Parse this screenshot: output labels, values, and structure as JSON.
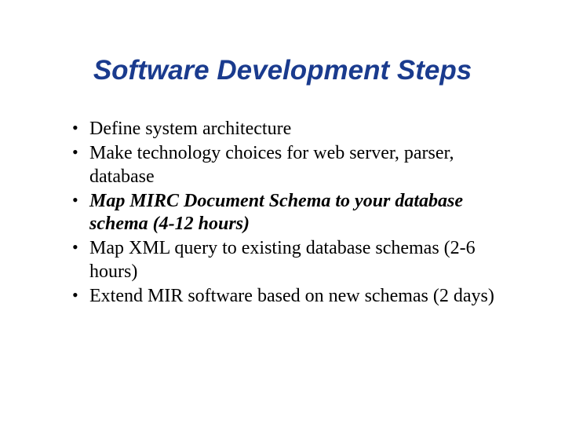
{
  "title": "Software Development Steps",
  "bullets": [
    {
      "text": "Define system architecture",
      "emphasis": "none"
    },
    {
      "text": "Make technology choices for web server, parser, database",
      "emphasis": "none"
    },
    {
      "text": "Map MIRC Document Schema to your database schema (4-12 hours)",
      "emphasis": "bold-italic"
    },
    {
      "text": "Map XML query to existing database schemas (2-6 hours)",
      "emphasis": "none"
    },
    {
      "text": "Extend MIR software based on new schemas (2 days)",
      "emphasis": "none"
    }
  ]
}
